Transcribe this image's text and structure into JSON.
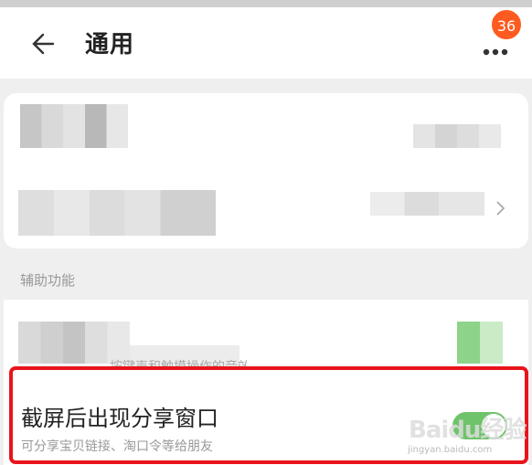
{
  "header": {
    "title": "通用",
    "badge_count": "36"
  },
  "section": {
    "label": "辅助功能"
  },
  "partial_text": "按键声和触摸操作的音效",
  "screenshot_share": {
    "title": "截屏后出现分享窗口",
    "subtitle": "可分享宝贝链接、淘口令等给朋友",
    "enabled": true
  },
  "watermark": {
    "line1": "Baidu经验",
    "line2": "jingyan.baidu.com"
  },
  "colors": {
    "accent": "#ff5a1f",
    "toggle_on": "#6fc36a",
    "highlight": "#e8141c"
  },
  "icons": {
    "back": "arrow-left-icon",
    "more": "more-dots-icon",
    "chevron": "chevron-right-icon"
  }
}
